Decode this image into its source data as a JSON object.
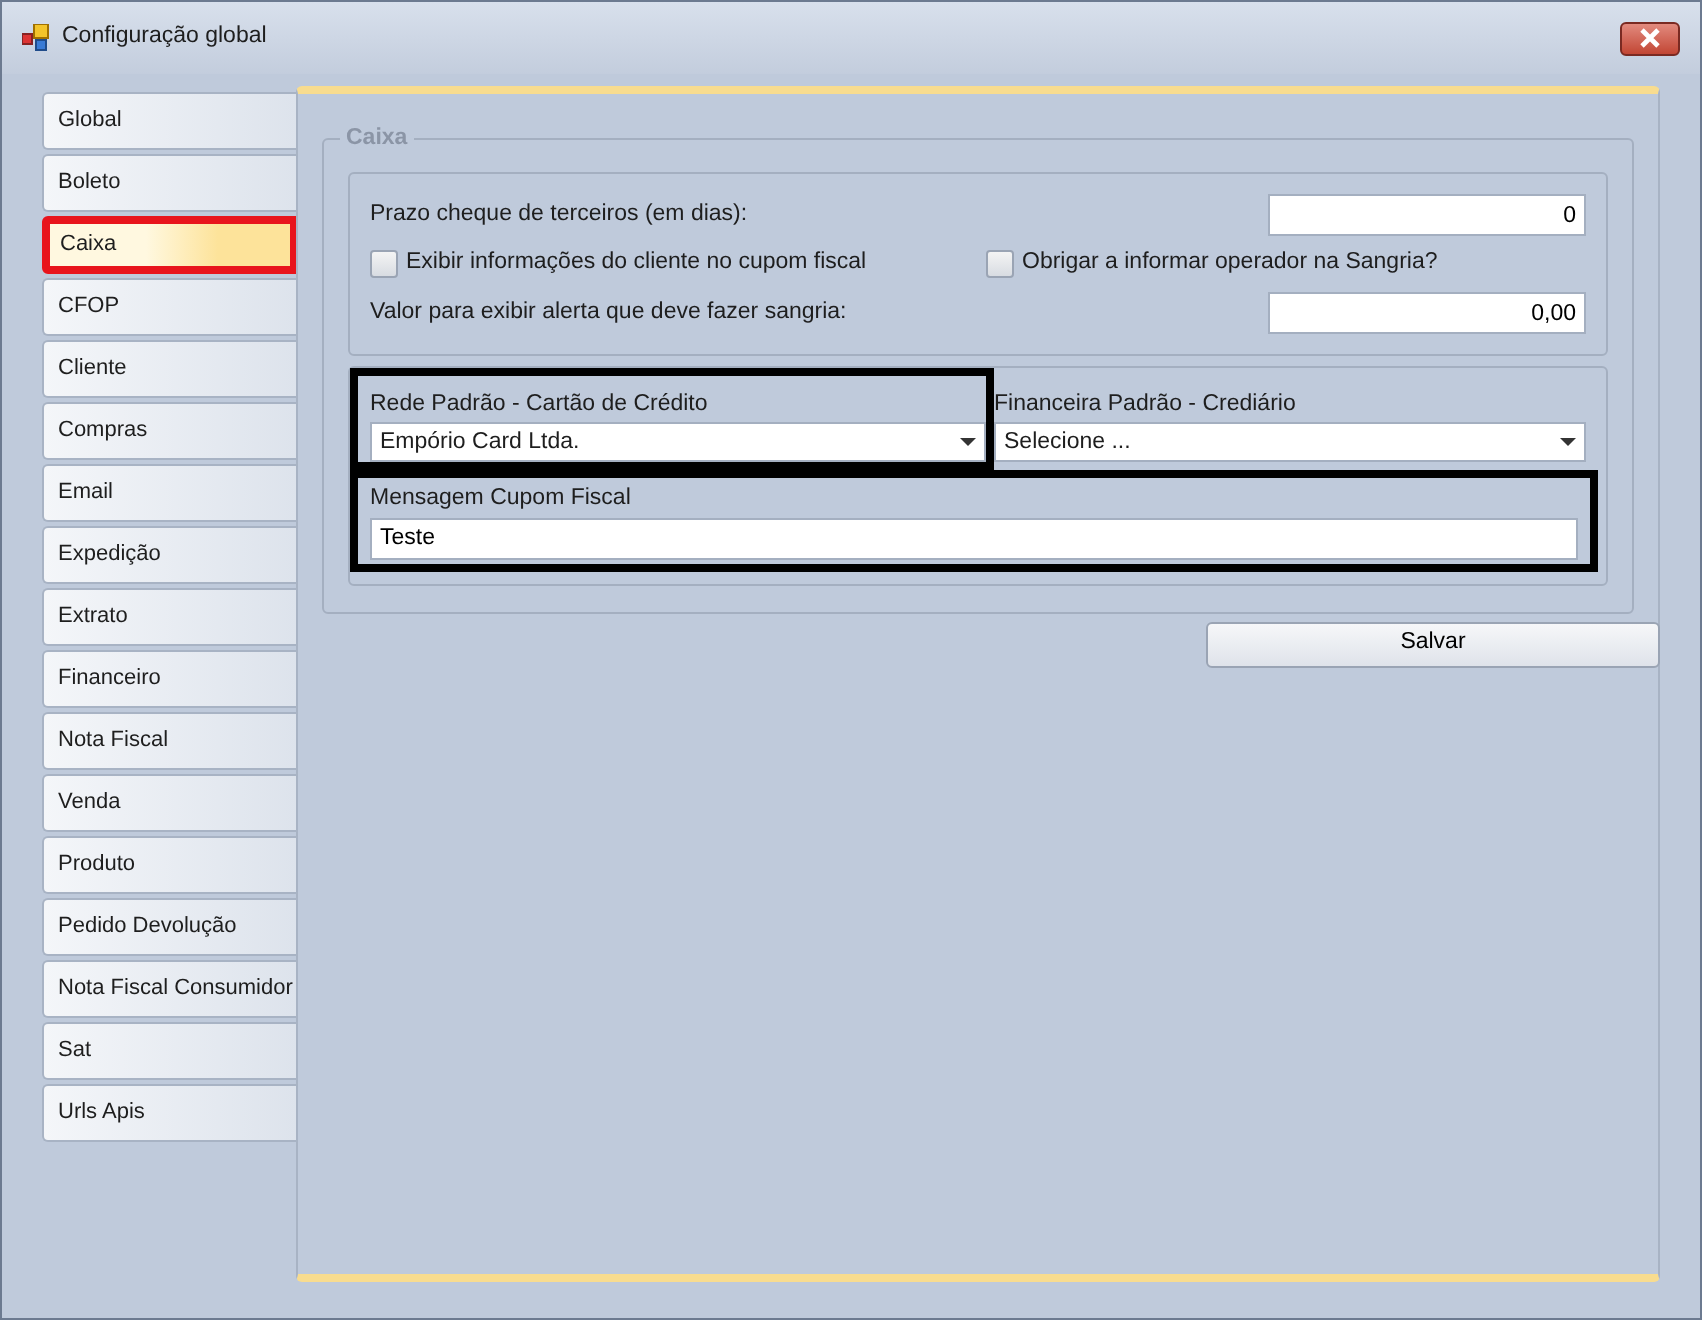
{
  "window": {
    "title": "Configuração global"
  },
  "tabs": [
    {
      "label": "Global",
      "selected": false
    },
    {
      "label": "Boleto",
      "selected": false
    },
    {
      "label": "Caixa",
      "selected": true
    },
    {
      "label": "CFOP",
      "selected": false
    },
    {
      "label": "Cliente",
      "selected": false
    },
    {
      "label": "Compras",
      "selected": false
    },
    {
      "label": "Email",
      "selected": false
    },
    {
      "label": "Expedição",
      "selected": false
    },
    {
      "label": "Extrato",
      "selected": false
    },
    {
      "label": "Financeiro",
      "selected": false
    },
    {
      "label": "Nota Fiscal",
      "selected": false
    },
    {
      "label": "Venda",
      "selected": false
    },
    {
      "label": "Produto",
      "selected": false
    },
    {
      "label": "Pedido Devolução",
      "selected": false
    },
    {
      "label": "Nota Fiscal Consumidor",
      "selected": false
    },
    {
      "label": "Sat",
      "selected": false
    },
    {
      "label": "Urls Apis",
      "selected": false
    }
  ],
  "group": {
    "title": "Caixa",
    "prazo": {
      "label": "Prazo cheque de terceiros (em dias):",
      "value": "0"
    },
    "checkboxes": [
      {
        "label": "Exibir informações do cliente no cupom fiscal",
        "checked": false
      },
      {
        "label": "Obrigar a informar operador na Sangria?",
        "checked": false
      }
    ],
    "alerta": {
      "label": "Valor para exibir alerta que deve fazer sangria:",
      "value": "0,00"
    },
    "rede": {
      "label": "Rede Padrão - Cartão de Crédito",
      "value": "Empório Card Ltda.",
      "highlighted": true
    },
    "financeira": {
      "label": "Financeira Padrão - Crediário",
      "value": "Selecione ..."
    },
    "mensagem": {
      "label": "Mensagem Cupom Fiscal",
      "value": "Teste",
      "highlighted": true
    }
  },
  "buttons": [
    "Salvar"
  ]
}
